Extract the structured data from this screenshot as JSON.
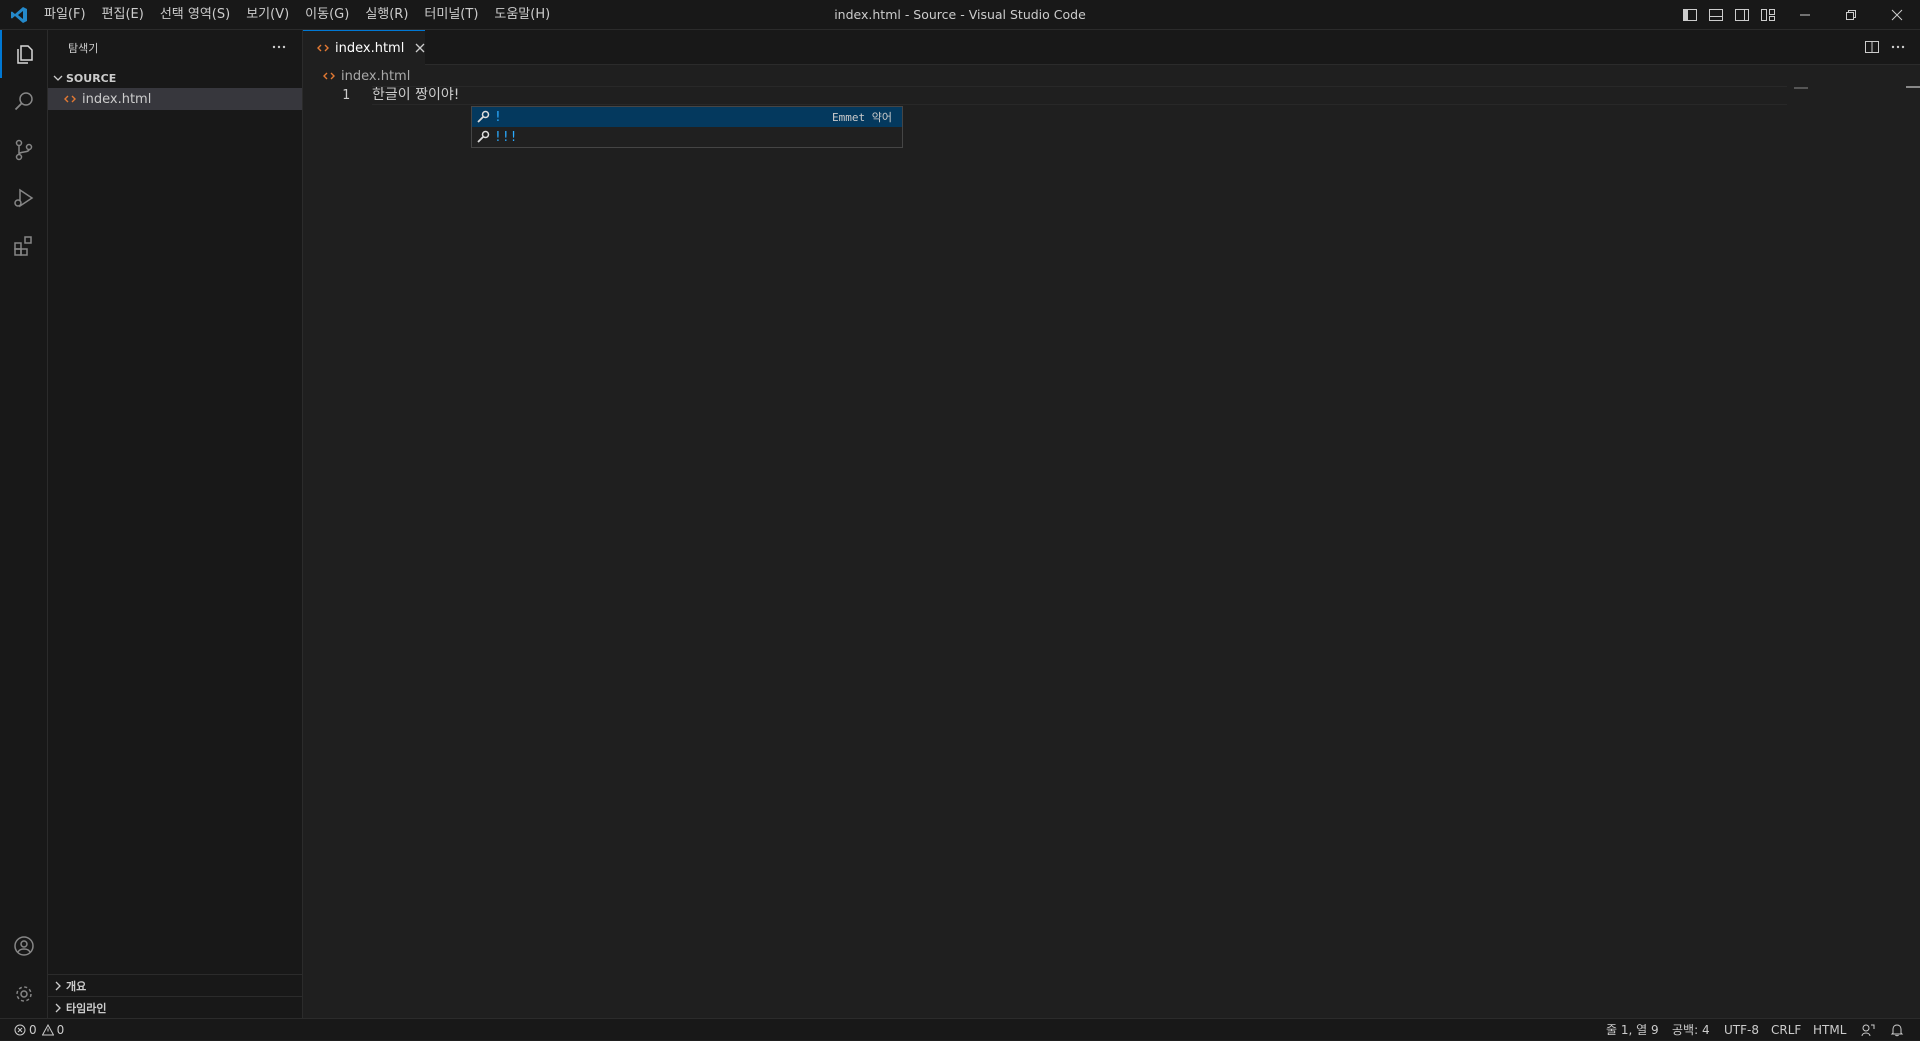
{
  "titlebar": {
    "menu": [
      "파일(F)",
      "편집(E)",
      "선택 영역(S)",
      "보기(V)",
      "이동(G)",
      "실행(R)",
      "터미널(T)",
      "도움말(H)"
    ],
    "window_title": "index.html - Source - Visual Studio Code"
  },
  "sidebar": {
    "title": "탐색기",
    "folder": "SOURCE",
    "files": [
      "index.html"
    ],
    "sections": [
      "개요",
      "타임라인"
    ]
  },
  "editor": {
    "tab_label": "index.html",
    "breadcrumb": "index.html",
    "line_number": "1",
    "code": "한글이 짱이야!"
  },
  "suggest": {
    "items": [
      {
        "label": "!",
        "detail": "Emmet 약어",
        "selected": true
      },
      {
        "label": "!!!",
        "detail": "",
        "selected": false
      }
    ]
  },
  "statusbar": {
    "errors": "0",
    "warnings": "0",
    "position": "줄 1, 열 9",
    "spaces": "공백: 4",
    "encoding": "UTF-8",
    "eol": "CRLF",
    "language": "HTML"
  },
  "colors": {
    "accent": "#0078d4",
    "html_icon": "#e37933",
    "suggest_label": "#2aaaff"
  }
}
